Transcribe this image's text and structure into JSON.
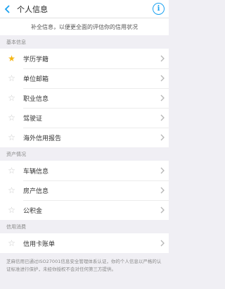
{
  "header": {
    "title": "个人信息",
    "back_icon": "arrow-left-icon",
    "info_icon": "info-icon",
    "info_glyph": "i"
  },
  "notice": "补全信息，以便更全面的评估你的信用状况",
  "sections": [
    {
      "title": "基本信息",
      "items": [
        {
          "label": "学历学籍",
          "starred": true
        },
        {
          "label": "单位邮箱",
          "starred": false
        },
        {
          "label": "职业信息",
          "starred": false
        },
        {
          "label": "驾驶证",
          "starred": false
        },
        {
          "label": "海外信用报告",
          "starred": false
        }
      ]
    },
    {
      "title": "资产情况",
      "items": [
        {
          "label": "车辆信息",
          "starred": false
        },
        {
          "label": "房产信息",
          "starred": false
        },
        {
          "label": "公积金",
          "starred": false
        }
      ]
    },
    {
      "title": "信用消费",
      "items": [
        {
          "label": "信用卡账单",
          "starred": false
        }
      ]
    }
  ],
  "footer": "芝麻信用已通过ISO27001信息安全管理体系认证，你的个人信息以严格的认证标准进行保护，未经你授权不会对任何第三方提供。",
  "colors": {
    "accent": "#1aa1f0",
    "star_active": "#f5b613",
    "star_inactive": "#c8c8c8"
  }
}
